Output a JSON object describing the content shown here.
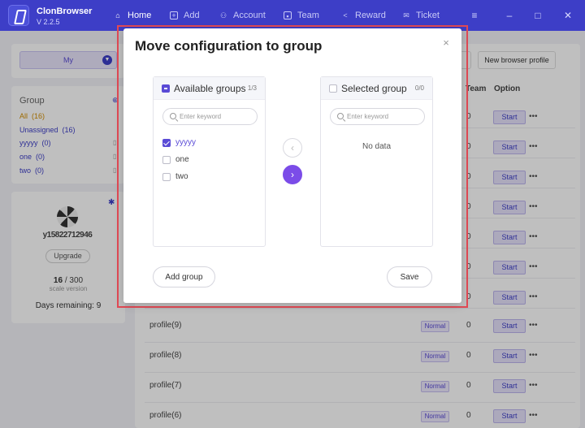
{
  "app": {
    "name": "ClonBrowser",
    "version": "V 2.2.5"
  },
  "nav": [
    {
      "label": "Home",
      "icon": "home-icon"
    },
    {
      "label": "Add",
      "icon": "plus-icon"
    },
    {
      "label": "Account",
      "icon": "account-icon"
    },
    {
      "label": "Team",
      "icon": "team-icon"
    },
    {
      "label": "Reward",
      "icon": "share-icon"
    },
    {
      "label": "Ticket",
      "icon": "ticket-icon"
    }
  ],
  "sidebar": {
    "filter_value": "My",
    "group_title": "Group",
    "groups": [
      {
        "label": "All",
        "count": "(16)"
      },
      {
        "label": "Unassigned",
        "count": "(16)"
      },
      {
        "label": "yyyyy",
        "count": "(0)"
      },
      {
        "label": "one",
        "count": "(0)"
      },
      {
        "label": "two",
        "count": "(0)"
      }
    ],
    "user_id": "y15822712946",
    "upgrade_label": "Upgrade",
    "quota_used": "16",
    "quota_total": "/ 300",
    "scale_label": "scale version",
    "days_label": "Days remaining:",
    "days_value": "9"
  },
  "toolbar": {
    "new_profile_label": "New browser profile"
  },
  "table": {
    "columns": {
      "team": "Team",
      "option": "Option"
    },
    "start_label": "Start",
    "more_label": "•••",
    "rows_hidden": [
      {
        "team": "0"
      },
      {
        "team": "0"
      },
      {
        "team": "0"
      },
      {
        "team": "0"
      },
      {
        "team": "0"
      },
      {
        "team": "0"
      },
      {
        "team": "0"
      }
    ],
    "rows": [
      {
        "name": "profile(9)",
        "status": "Normal",
        "team": "0"
      },
      {
        "name": "profile(8)",
        "status": "Normal",
        "team": "0"
      },
      {
        "name": "profile(7)",
        "status": "Normal",
        "team": "0"
      },
      {
        "name": "profile(6)",
        "status": "Normal",
        "team": "0"
      }
    ]
  },
  "modal": {
    "title": "Move configuration to group",
    "close_glyph": "×",
    "available": {
      "title": "Available groups",
      "count": "1/3",
      "search_placeholder": "Enter keyword",
      "items": [
        {
          "label": "yyyyy",
          "checked": true
        },
        {
          "label": "one",
          "checked": false
        },
        {
          "label": "two",
          "checked": false
        }
      ]
    },
    "selected": {
      "title": "Selected group",
      "count": "0/0",
      "search_placeholder": "Enter keyword",
      "empty_text": "No data"
    },
    "move_left_glyph": "‹",
    "move_right_glyph": "›",
    "add_group_label": "Add group",
    "save_label": "Save"
  }
}
